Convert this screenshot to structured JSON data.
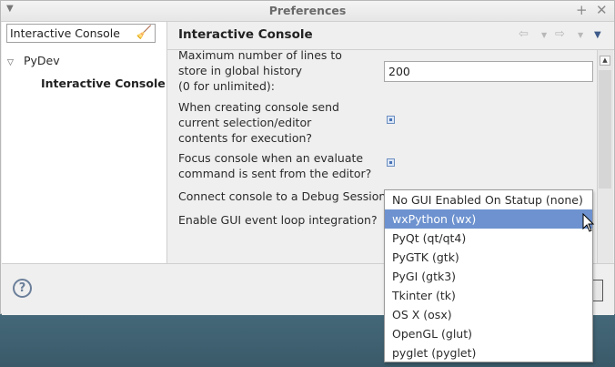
{
  "window": {
    "title": "Preferences"
  },
  "sidebar": {
    "filter_value": "Interactive Console",
    "tree": [
      {
        "label": "PyDev"
      },
      {
        "label": "Interactive Console"
      }
    ]
  },
  "page": {
    "title": "Interactive Console"
  },
  "settings": {
    "history_label_l1": "Maximum number of lines to",
    "history_label_l2": "store in global history",
    "history_label_l3": "(0 for unlimited):",
    "history_value": "200",
    "send_sel_l1": "When creating console send",
    "send_sel_l2": "current selection/editor",
    "send_sel_l3": "contents for execution?",
    "focus_l1": "Focus console when an evaluate",
    "focus_l2": "command is sent from the editor?",
    "debug_label": "Connect console to a Debug Session?",
    "gui_label": "Enable GUI event loop integration?"
  },
  "dropdown": {
    "options": [
      "No GUI Enabled On Statup (none)",
      "wxPython (wx)",
      "PyQt (qt/qt4)",
      "PyGTK (gtk)",
      "PyGI (gtk3)",
      "Tkinter (tk)",
      "OS X (osx)",
      "OpenGL (glut)",
      "pyglet (pyglet)"
    ],
    "selected": "wxPython (wx)"
  },
  "icons": {
    "help": "help-icon",
    "clear": "clear-filter-icon",
    "back": "back-arrow-icon",
    "forward": "forward-arrow-icon",
    "view_menu": "view-menu-icon"
  },
  "colors": {
    "selection": "#6d92cf",
    "desktop": "#3f6273"
  }
}
